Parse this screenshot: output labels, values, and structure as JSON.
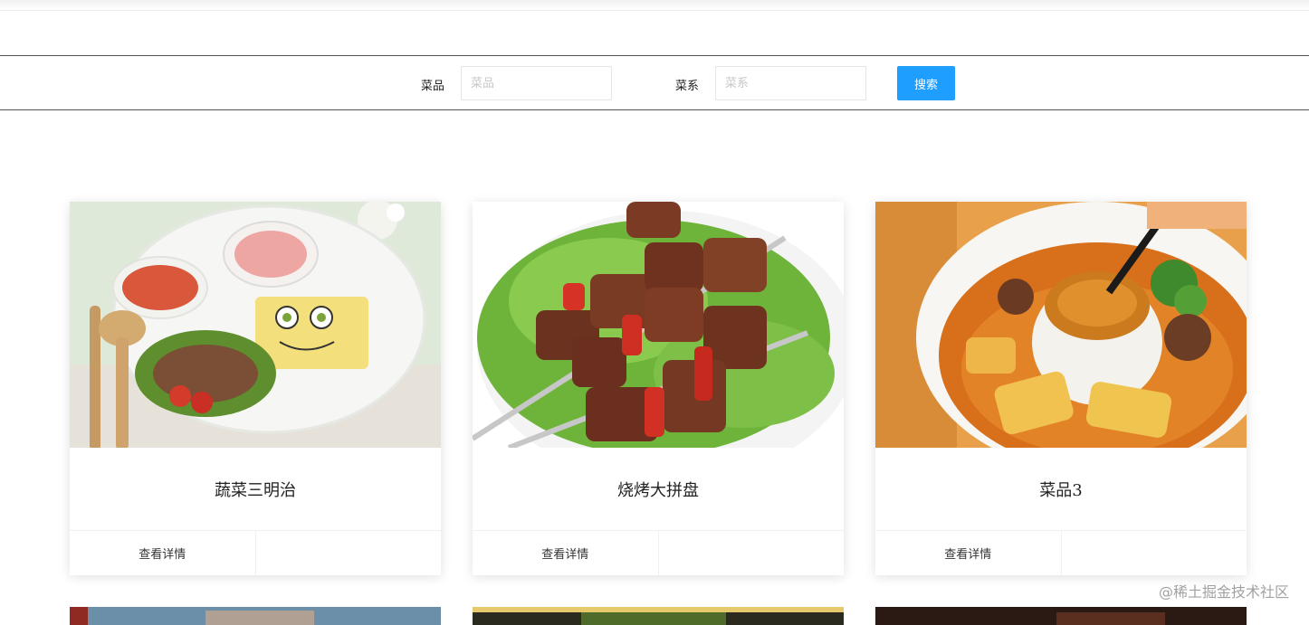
{
  "search": {
    "dish_label": "菜品",
    "dish_placeholder": "菜品",
    "cuisine_label": "菜系",
    "cuisine_placeholder": "菜系",
    "button_label": "搜索"
  },
  "cards": [
    {
      "title": "蔬菜三明治",
      "action_label": "查看详情"
    },
    {
      "title": "烧烤大拼盘",
      "action_label": "查看详情"
    },
    {
      "title": "菜品3",
      "action_label": "查看详情"
    }
  ],
  "watermark": "@稀土掘金技术社区",
  "colors": {
    "accent": "#1e9fff",
    "border": "#555555"
  }
}
